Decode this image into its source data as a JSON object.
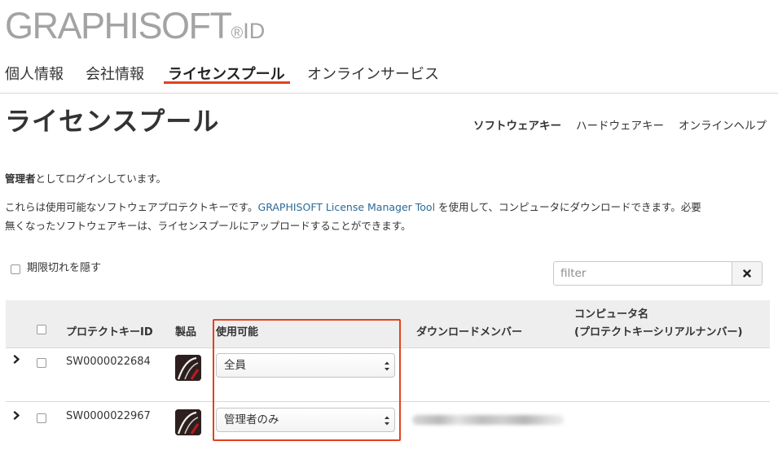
{
  "logo": {
    "main": "GRAPHISOFT",
    "dot": "®",
    "suffix": "ID"
  },
  "tabs": [
    {
      "label": "個人情報",
      "active": false
    },
    {
      "label": "会社情報",
      "active": false
    },
    {
      "label": "ライセンスプール",
      "active": true
    },
    {
      "label": "オンラインサービス",
      "active": false
    }
  ],
  "page_title": "ライセンスプール",
  "subnav": [
    {
      "label": "ソフトウェアキー",
      "active": true
    },
    {
      "label": "ハードウェアキー",
      "active": false
    },
    {
      "label": "オンラインヘルプ",
      "active": false
    }
  ],
  "info": {
    "login_bold": "管理者",
    "login_rest": "としてログインしています。",
    "desc_1a": "これらは使用可能なソフトウェアプロテクトキーです。",
    "desc_link": "GRAPHISOFT License Manager Tool",
    "desc_1b": " を使用して、コンピュータにダウンロードできます。必要",
    "desc_2": "無くなったソフトウェアキーは、ライセンスプールにアップロードすることができます。"
  },
  "hide_expired_label": "期限切れを隠す",
  "filter": {
    "placeholder": "filter",
    "value": ""
  },
  "table": {
    "headers": {
      "key_id": "プロテクトキーID",
      "product": "製品",
      "availability": "使用可能",
      "download_member": "ダウンロードメンバー",
      "computer_name_1": "コンピュータ名",
      "computer_name_2": "(プロテクトキーシリアルナンバー)"
    },
    "rows": [
      {
        "key_id": "SW0000022684",
        "availability": "全員",
        "download_member": "",
        "computer_name": ""
      },
      {
        "key_id": "SW0000022967",
        "availability": "管理者のみ",
        "download_member": "",
        "computer_name": ""
      }
    ]
  },
  "colors": {
    "accent": "#e4401f",
    "link": "#2a6a96",
    "logo": "#a3a3a3",
    "header_bg": "#eeeeee"
  },
  "icons": [
    "close-icon",
    "chevron-right-icon",
    "archicad-product-icon",
    "select-arrows-icon"
  ]
}
